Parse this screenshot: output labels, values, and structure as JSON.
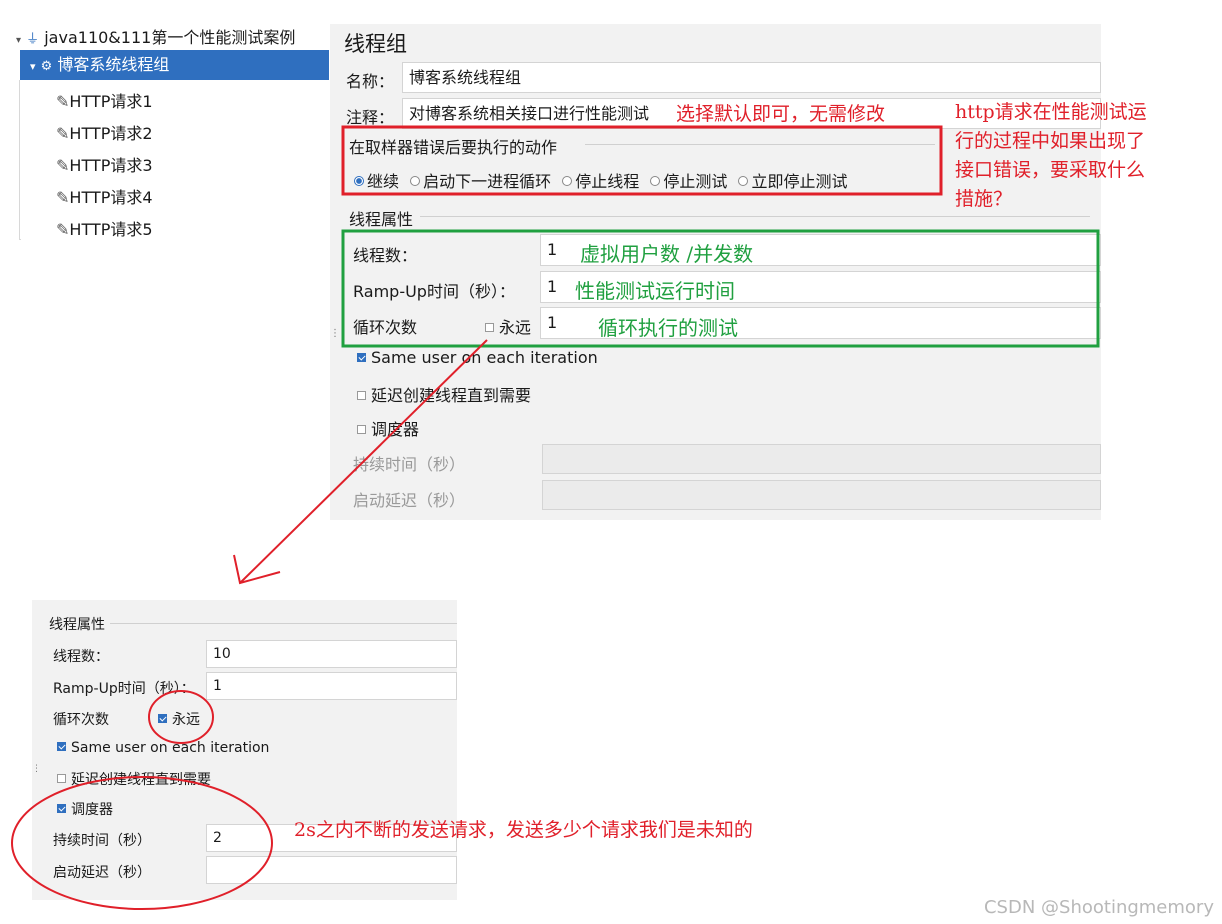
{
  "tree": {
    "root": "java110&111第一个性能测试案例",
    "selected": "博客系统线程组",
    "items": [
      "HTTP请求1",
      "HTTP请求2",
      "HTTP请求3",
      "HTTP请求4",
      "HTTP请求5"
    ]
  },
  "panel": {
    "title": "线程组",
    "name_label": "名称：",
    "name_value": "博客系统线程组",
    "comment_label": "注释：",
    "comment_value": "对博客系统相关接口进行性能测试",
    "error_action_title": "在取样器错误后要执行的动作",
    "error_actions": [
      "继续",
      "启动下一进程循环",
      "停止线程",
      "停止测试",
      "立即停止测试"
    ],
    "thread_props_title": "线程属性",
    "threads_label": "线程数：",
    "threads_value": "1",
    "rampup_label": "Ramp-Up时间（秒）：",
    "rampup_value": "1",
    "loop_label": "循环次数",
    "forever_label": "永远",
    "loop_value": "1",
    "same_user_label": "Same user on each iteration",
    "delay_label": "延迟创建线程直到需要",
    "scheduler_label": "调度器",
    "duration_label": "持续时间（秒）",
    "startup_delay_label": "启动延迟（秒）"
  },
  "panel2": {
    "thread_props_title": "线程属性",
    "threads_label": "线程数：",
    "threads_value": "10",
    "rampup_label": "Ramp-Up时间（秒）：",
    "rampup_value": "1",
    "loop_label": "循环次数",
    "forever_label": "永远",
    "same_user_label": "Same user on each iteration",
    "delay_label": "延迟创建线程直到需要",
    "scheduler_label": "调度器",
    "duration_label": "持续时间（秒）",
    "duration_value": "2",
    "startup_delay_label": "启动延迟（秒）"
  },
  "annotations": {
    "default_note": "选择默认即可，无需修改",
    "http_note": [
      "http请求在性能测试运",
      "行的过程中如果出现了",
      "接口错误，要采取什么",
      "措施？"
    ],
    "virtual_users": "虚拟用户数 /并发数",
    "run_time": "性能测试运行时间",
    "loop_test": "循环执行的测试",
    "two_seconds": "2s之内不断的发送请求，发送多少个请求我们是未知的"
  },
  "watermark": "CSDN @Shootingmemory",
  "colors": {
    "annotation_red": "#e0202a",
    "annotation_green": "#20a040",
    "selection_blue": "#2f6fbf"
  }
}
